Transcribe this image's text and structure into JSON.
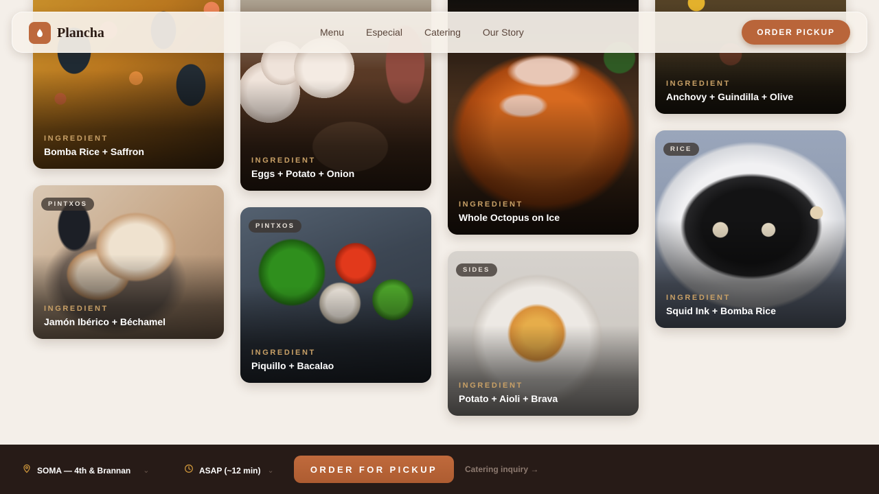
{
  "nav": {
    "brand": "Plancha",
    "links": [
      "Menu",
      "Especial",
      "Catering",
      "Our Story"
    ],
    "cta": "ORDER PICKUP"
  },
  "cards": [
    {
      "tag": "",
      "eyebrow": "INGREDIENT",
      "title": "Bomba Rice + Saffron",
      "icon": "paella-photo"
    },
    {
      "tag": "PINTXOS",
      "eyebrow": "INGREDIENT",
      "title": "Jamón Ibérico + Béchamel",
      "icon": "bread-photo"
    },
    {
      "tag": "",
      "eyebrow": "INGREDIENT",
      "title": "Eggs + Potato + Onion",
      "icon": "eggs-photo"
    },
    {
      "tag": "PINTXOS",
      "eyebrow": "INGREDIENT",
      "title": "Piquillo + Bacalao",
      "icon": "peppers-photo"
    },
    {
      "tag": "",
      "eyebrow": "INGREDIENT",
      "title": "Whole Octopus on Ice",
      "icon": "octopus-photo"
    },
    {
      "tag": "SIDES",
      "eyebrow": "INGREDIENT",
      "title": "Potato + Aioli + Brava",
      "icon": "potatoes-photo"
    },
    {
      "tag": "",
      "eyebrow": "INGREDIENT",
      "title": "Anchovy + Guindilla + Olive",
      "icon": "anchovy-photo"
    },
    {
      "tag": "RICE",
      "eyebrow": "INGREDIENT",
      "title": "Squid Ink + Bomba Rice",
      "icon": "squid-photo"
    }
  ],
  "bottom": {
    "location": "SOMA — 4th & Brannan",
    "time": "ASAP (~12 min)",
    "cta": "ORDER FOR PICKUP",
    "link": "Catering inquiry →"
  },
  "colors": {
    "accent": "#b9653a",
    "eyebrow": "#c8a066",
    "bottom_bar": "#271b17",
    "background": "#f4efe9"
  }
}
